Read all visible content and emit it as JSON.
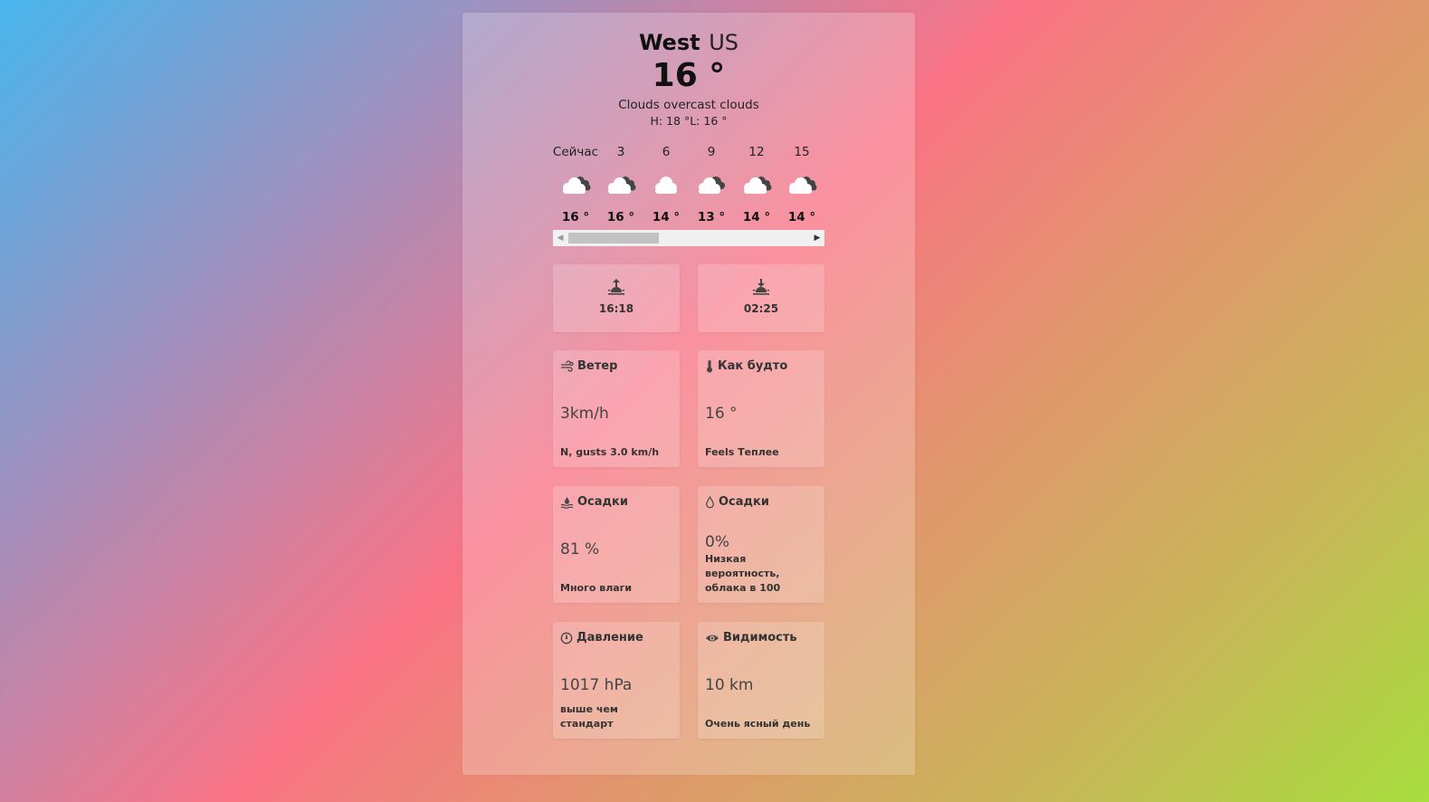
{
  "location": {
    "city": "West",
    "country": "US"
  },
  "current": {
    "temp": "16 °",
    "description": "Clouds overcast clouds",
    "high_low": "H: 18 °L: 16 °"
  },
  "hourly": [
    {
      "label": "Сейчас",
      "temp": "16 °",
      "icon": "cloud-overcast-icon"
    },
    {
      "label": "3",
      "temp": "16 °",
      "icon": "cloud-overcast-icon"
    },
    {
      "label": "6",
      "temp": "14 °",
      "icon": "cloud-icon"
    },
    {
      "label": "9",
      "temp": "13 °",
      "icon": "cloud-overcast-icon"
    },
    {
      "label": "12",
      "temp": "14 °",
      "icon": "cloud-overcast-icon"
    },
    {
      "label": "15",
      "temp": "14 °",
      "icon": "cloud-overcast-icon"
    }
  ],
  "sun": {
    "sunrise": "16:18",
    "sunset": "02:25"
  },
  "cards": {
    "wind": {
      "title": "Ветер",
      "value": "3km/h",
      "note": "N, gusts 3.0 km/h",
      "icon": "wind-icon"
    },
    "feels": {
      "title": "Как будто",
      "value": "16 °",
      "note": "Feels Теплее",
      "icon": "thermometer-icon"
    },
    "humidity": {
      "title": "Осадки",
      "value": "81 %",
      "note": "Много влаги",
      "icon": "humidity-icon"
    },
    "precip": {
      "title": "Осадки",
      "value": "0%",
      "note": "Низкая вероятность, облака в 100",
      "icon": "droplet-icon"
    },
    "pressure": {
      "title": "Давление",
      "value": "1017 hPa",
      "note": "выше чем стандарт",
      "icon": "gauge-icon"
    },
    "visibility": {
      "title": "Видимость",
      "value": "10 km",
      "note": "Очень ясный день",
      "icon": "eye-icon"
    }
  },
  "colors": {
    "gradient": [
      "#48b6ee",
      "#f97384",
      "#a6de3c"
    ],
    "cloud_light": "#ffffff",
    "cloud_dark": "#444444"
  }
}
